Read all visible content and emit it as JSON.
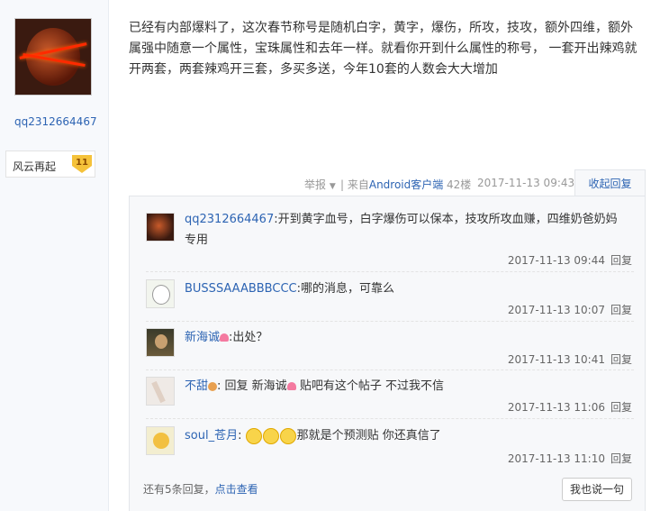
{
  "author": {
    "username": "qq2312664467",
    "level_title": "风云再起",
    "level": "11"
  },
  "post": {
    "lines": [
      "已经有内部爆料了，这次春节称号是随机白字，黄字，爆伤，所攻，技攻，额外四维，额外",
      "属强中随意一个属性，宝珠属性和去年一样。就看你开到什么属性的称号， 一套开出辣鸡就",
      "开两套，两套辣鸡开三套，多买多送，今年10套的人数会大大增加"
    ],
    "report": "举报",
    "source_prefix": "| 来自",
    "source_app": "Android客户端",
    "floor": "42楼",
    "time": "2017-11-13 09:43",
    "collapse_label": "收起回复"
  },
  "replies": [
    {
      "name": "qq2312664467",
      "text": "开到黄字血号，白字爆伤可以保本，技攻所攻血赚，四维奶爸奶妈",
      "text2": "专用",
      "time": "2017-11-13 09:44",
      "reply": "回复"
    },
    {
      "name": "BUSSSAAABBBCCC",
      "text": "哪的消息，可靠么",
      "time": "2017-11-13 10:07",
      "reply": "回复"
    },
    {
      "name": "新海诚",
      "text": "出处？",
      "time": "2017-11-13 10:41",
      "reply": "回复"
    },
    {
      "name": "不甜",
      "text_prefix": " 回复 ",
      "target": "新海诚",
      "text": " 贴吧有这个帖子 不过我不信",
      "time": "2017-11-13 11:06",
      "reply": "回复"
    },
    {
      "name": "soul_苍月",
      "text": "那就是个预测贴 你还真信了",
      "time": "2017-11-13 11:10",
      "reply": "回复"
    }
  ],
  "footer": {
    "more_text": "还有5条回复，",
    "more_link": "点击查看",
    "say_button": "我也说一句"
  },
  "colors": {
    "link": "#2d64b3",
    "panel": "#f7f8fa"
  }
}
